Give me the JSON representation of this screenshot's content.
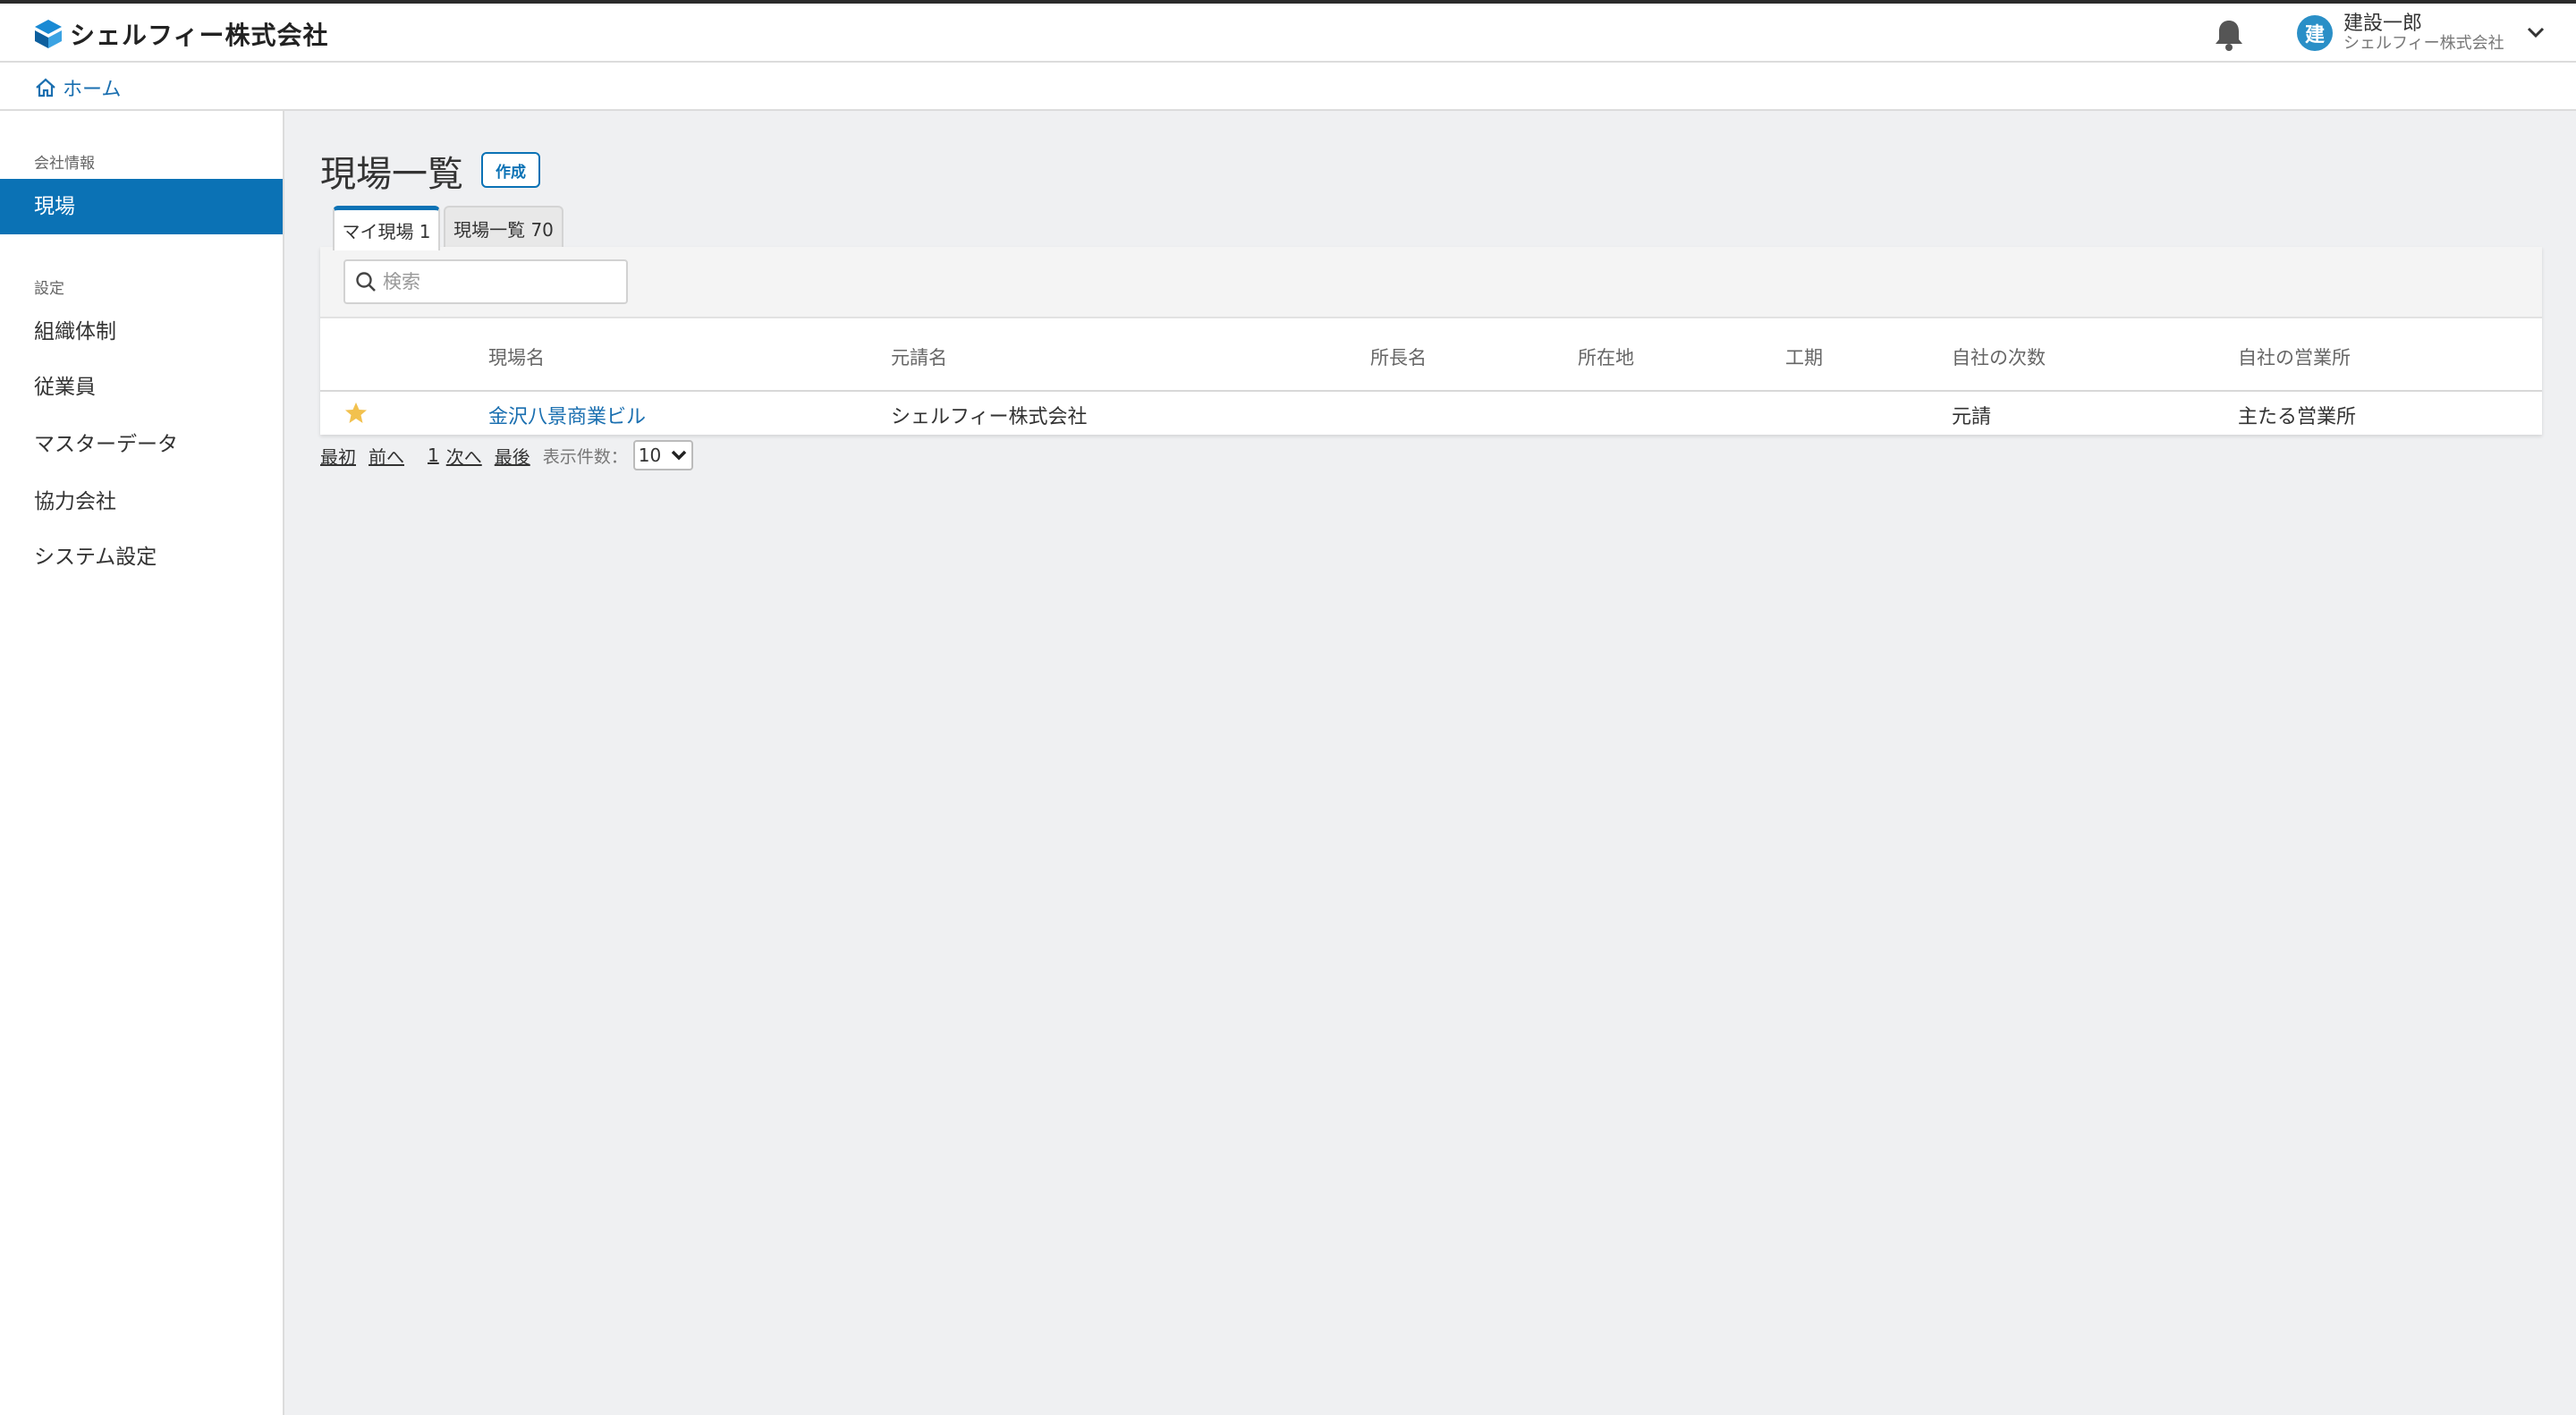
{
  "app": {
    "company_name": "シェルフィー株式会社"
  },
  "header": {
    "user": {
      "avatar_initial": "建",
      "name": "建設一郎",
      "company": "シェルフィー株式会社"
    }
  },
  "breadcrumb": {
    "home_label": "ホーム"
  },
  "sidebar": {
    "sections": [
      {
        "label": "会社情報",
        "items": [
          {
            "label": "現場",
            "active": true
          }
        ]
      },
      {
        "label": "設定",
        "items": [
          {
            "label": "組織体制"
          },
          {
            "label": "従業員"
          },
          {
            "label": "マスターデータ"
          },
          {
            "label": "協力会社"
          },
          {
            "label": "システム設定"
          }
        ]
      }
    ]
  },
  "main": {
    "title": "現場一覧",
    "create_label": "作成",
    "tabs": [
      {
        "label": "マイ現場 1",
        "active": true
      },
      {
        "label": "現場一覧 70",
        "active": false
      }
    ],
    "search": {
      "placeholder": "検索",
      "value": ""
    },
    "table": {
      "columns": [
        "現場名",
        "元請名",
        "所長名",
        "所在地",
        "工期",
        "自社の次数",
        "自社の営業所"
      ],
      "rows": [
        {
          "favorite": true,
          "site_name": "金沢八景商業ビル",
          "prime_contractor": "シェルフィー株式会社",
          "manager": "",
          "location": "",
          "period": "",
          "tier": "元請",
          "office": "主たる営業所"
        }
      ]
    },
    "pagination": {
      "first": "最初",
      "prev": "前へ",
      "page": "1",
      "next": "次へ",
      "last": "最後",
      "per_page_label": "表示件数：",
      "per_page_value": "10"
    }
  },
  "colors": {
    "accent": "#0b72b5",
    "link": "#1a6fb0",
    "star": "#f2c14e",
    "avatar": "#2a8fc7"
  }
}
